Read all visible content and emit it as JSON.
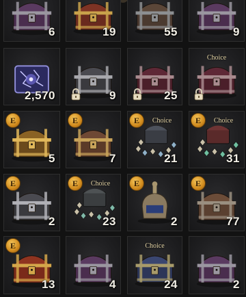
{
  "inventory": {
    "items": [
      {
        "count": "6",
        "choice": "",
        "e_badge": false,
        "locked": false,
        "type": "chest",
        "theme": "purple",
        "body": "#4a2d4e",
        "lid": "#5a3a60",
        "trim": "#9a96a0"
      },
      {
        "count": "19",
        "choice": "",
        "e_badge": false,
        "locked": false,
        "type": "chest",
        "theme": "red-gold",
        "body": "#6a2a1e",
        "lid": "#7d3324",
        "trim": "#c9a24b"
      },
      {
        "count": "55",
        "choice": "",
        "e_badge": false,
        "locked": false,
        "type": "chest",
        "theme": "wood-steel",
        "body": "#4b3a30",
        "lid": "#5a4638",
        "trim": "#8d8f92"
      },
      {
        "count": "9",
        "choice": "",
        "e_badge": false,
        "locked": false,
        "type": "chest",
        "theme": "purple",
        "body": "#4a2d4e",
        "lid": "#5a3a60",
        "trim": "#9a96a0"
      },
      {
        "count": "2,570",
        "choice": "",
        "e_badge": false,
        "locked": false,
        "type": "orb",
        "theme": "arcane",
        "body": "#2b2a5e",
        "lid": "#3c3a80",
        "trim": "#8f8dd8"
      },
      {
        "count": "9",
        "choice": "",
        "e_badge": false,
        "locked": true,
        "type": "chest",
        "theme": "steel",
        "body": "#3a3a3e",
        "lid": "#4a4a50",
        "trim": "#a8a8ad"
      },
      {
        "count": "25",
        "choice": "",
        "e_badge": false,
        "locked": true,
        "type": "chest",
        "theme": "crimson",
        "body": "#4b1f2a",
        "lid": "#5e2836",
        "trim": "#a88a8e"
      },
      {
        "count": "",
        "choice": "Choice",
        "e_badge": false,
        "locked": true,
        "type": "chest",
        "theme": "crimson",
        "body": "#4b1f2a",
        "lid": "#5e2836",
        "trim": "#a88a8e"
      },
      {
        "count": "5",
        "choice": "",
        "e_badge": true,
        "locked": false,
        "type": "chest",
        "theme": "gold",
        "body": "#6b4a1c",
        "lid": "#8a6224",
        "trim": "#e0b75a"
      },
      {
        "count": "7",
        "choice": "",
        "e_badge": true,
        "locked": false,
        "type": "chest",
        "theme": "bronze",
        "body": "#5b3a28",
        "lid": "#6e4834",
        "trim": "#c8a35a"
      },
      {
        "count": "21",
        "choice": "Choice",
        "e_badge": true,
        "locked": false,
        "type": "pile",
        "theme": "steel-gems",
        "body": "#3a3d44",
        "lid": "#4d525c",
        "trim": "#8fb0c8"
      },
      {
        "count": "31",
        "choice": "Choice",
        "e_badge": true,
        "locked": false,
        "type": "pile",
        "theme": "red-gems",
        "body": "#5a2a2a",
        "lid": "#6e3434",
        "trim": "#6fbfa0"
      },
      {
        "count": "2",
        "choice": "",
        "e_badge": true,
        "locked": false,
        "type": "chest",
        "theme": "steel",
        "body": "#3a3a3e",
        "lid": "#4a4a50",
        "trim": "#b0b0b6"
      },
      {
        "count": "23",
        "choice": "Choice",
        "e_badge": true,
        "locked": false,
        "type": "pile",
        "theme": "steel-gems",
        "body": "#3b3e40",
        "lid": "#4e5254",
        "trim": "#7fb8a8"
      },
      {
        "count": "2",
        "choice": "",
        "e_badge": true,
        "locked": false,
        "type": "urn",
        "theme": "ivory",
        "body": "#8a7a60",
        "lid": "#a8966f",
        "trim": "#2a3d78"
      },
      {
        "count": "77",
        "choice": "",
        "e_badge": true,
        "locked": false,
        "type": "chest",
        "theme": "wood",
        "body": "#5a4030",
        "lid": "#6b4c38",
        "trim": "#9a8f80"
      },
      {
        "count": "13",
        "choice": "",
        "e_badge": true,
        "locked": false,
        "type": "chest",
        "theme": "red-gold",
        "body": "#7a2a1a",
        "lid": "#8f3420",
        "trim": "#d4a64a"
      },
      {
        "count": "4",
        "choice": "",
        "e_badge": false,
        "locked": false,
        "type": "chest",
        "theme": "purple",
        "body": "#4a2d4e",
        "lid": "#5a3a60",
        "trim": "#9a96a0"
      },
      {
        "count": "24",
        "choice": "Choice",
        "e_badge": false,
        "locked": false,
        "type": "chest",
        "theme": "navy",
        "body": "#2c3658",
        "lid": "#3a4670",
        "trim": "#a89b6a"
      },
      {
        "count": "2",
        "choice": "",
        "e_badge": false,
        "locked": false,
        "type": "chest",
        "theme": "purple",
        "body": "#4a2d4e",
        "lid": "#5a3a60",
        "trim": "#9a96a0"
      }
    ],
    "e_badge_letter": "E"
  }
}
